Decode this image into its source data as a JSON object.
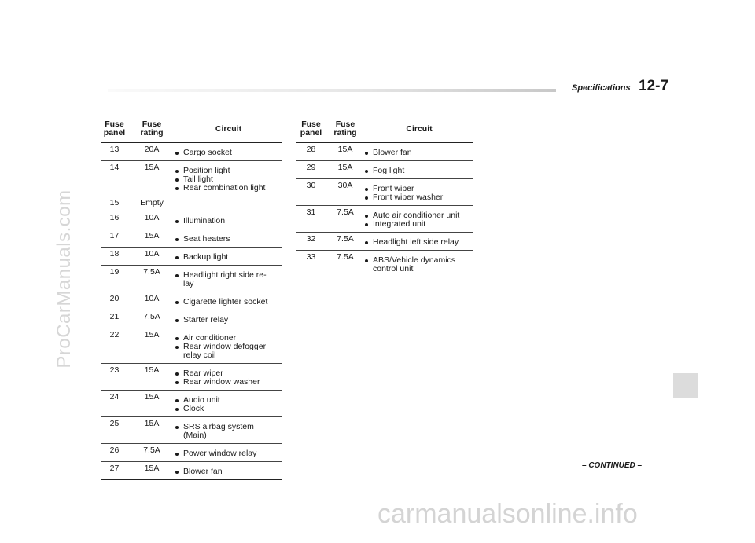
{
  "header": {
    "section": "Specifications",
    "page": "12-7"
  },
  "watermark_side": "ProCarManuals.com",
  "watermark_bottom": "carmanualsonline.info",
  "continued": "– CONTINUED –",
  "table_headers": {
    "panel": [
      "Fuse",
      "panel"
    ],
    "rating": [
      "Fuse",
      "rating"
    ],
    "circuit": "Circuit"
  },
  "left_rows": [
    {
      "panel": "13",
      "rating": "20A",
      "circuits": [
        "Cargo socket"
      ]
    },
    {
      "panel": "14",
      "rating": "15A",
      "circuits": [
        "Position light",
        "Tail light",
        "Rear combination light"
      ]
    },
    {
      "panel": "15",
      "rating": "Empty",
      "circuits": []
    },
    {
      "panel": "16",
      "rating": "10A",
      "circuits": [
        "Illumination"
      ]
    },
    {
      "panel": "17",
      "rating": "15A",
      "circuits": [
        "Seat heaters"
      ]
    },
    {
      "panel": "18",
      "rating": "10A",
      "circuits": [
        "Backup light"
      ]
    },
    {
      "panel": "19",
      "rating": "7.5A",
      "circuits": [
        [
          "Headlight right side re-",
          "lay"
        ]
      ]
    },
    {
      "panel": "20",
      "rating": "10A",
      "circuits": [
        "Cigarette lighter socket"
      ]
    },
    {
      "panel": "21",
      "rating": "7.5A",
      "circuits": [
        "Starter relay"
      ]
    },
    {
      "panel": "22",
      "rating": "15A",
      "circuits": [
        "Air conditioner",
        [
          "Rear window defogger",
          "relay coil"
        ]
      ]
    },
    {
      "panel": "23",
      "rating": "15A",
      "circuits": [
        "Rear wiper",
        "Rear window washer"
      ]
    },
    {
      "panel": "24",
      "rating": "15A",
      "circuits": [
        "Audio unit",
        "Clock"
      ]
    },
    {
      "panel": "25",
      "rating": "15A",
      "circuits": [
        [
          "SRS airbag system",
          "(Main)"
        ]
      ]
    },
    {
      "panel": "26",
      "rating": "7.5A",
      "circuits": [
        "Power window relay"
      ]
    },
    {
      "panel": "27",
      "rating": "15A",
      "circuits": [
        "Blower fan"
      ]
    }
  ],
  "right_rows": [
    {
      "panel": "28",
      "rating": "15A",
      "circuits": [
        "Blower fan"
      ]
    },
    {
      "panel": "29",
      "rating": "15A",
      "circuits": [
        "Fog light"
      ]
    },
    {
      "panel": "30",
      "rating": "30A",
      "circuits": [
        "Front wiper",
        "Front wiper washer"
      ]
    },
    {
      "panel": "31",
      "rating": "7.5A",
      "circuits": [
        "Auto air conditioner unit",
        "Integrated unit"
      ]
    },
    {
      "panel": "32",
      "rating": "7.5A",
      "circuits": [
        "Headlight left side relay"
      ]
    },
    {
      "panel": "33",
      "rating": "7.5A",
      "circuits": [
        [
          "ABS/Vehicle dynamics",
          "control unit"
        ]
      ]
    }
  ]
}
